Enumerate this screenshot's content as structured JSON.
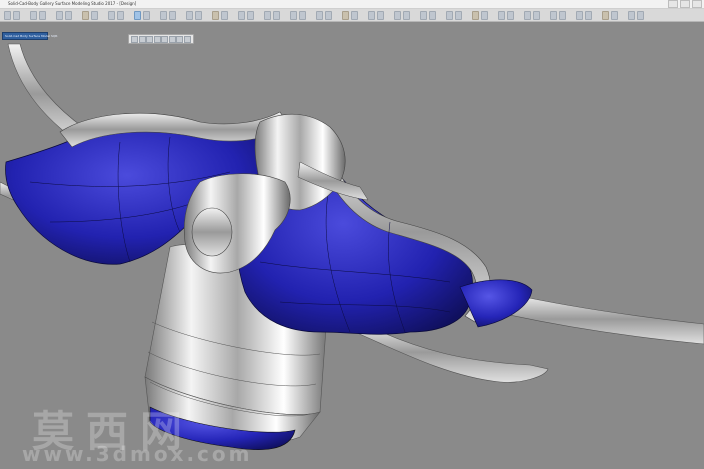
{
  "app": {
    "window_title": "Solid-Cad-Body Gallery Surface Modeling Studio 2017 - [Design]"
  },
  "document": {
    "tab_label": "Solid-Cad Body Surface Model SQR"
  },
  "colors": {
    "viewport_background": "#8a8a8a",
    "body_fill": "#2222b0",
    "body_highlight": "#4b4bdc",
    "chrome_light": "#eaeaea",
    "chrome_dark": "#7a7a7a",
    "titlebar": "#f2f2f2",
    "toolbar": "#d9d9d9",
    "doc_tab": "#2f5f9e"
  },
  "icons": {
    "toolbar": [
      "file-icon",
      "open-icon",
      "save-icon",
      "undo-icon",
      "redo-icon",
      "select-icon",
      "move-icon",
      "rotate-icon",
      "scale-icon",
      "curve-icon",
      "surface-icon",
      "trim-icon",
      "fillet-icon",
      "blend-icon",
      "mirror-icon",
      "array-icon",
      "measure-icon",
      "grid-icon",
      "snap-icon",
      "layer-icon",
      "material-icon",
      "render-icon",
      "camera-icon",
      "light-icon",
      "settings-icon"
    ],
    "view_toolbar": [
      "zoom-icon",
      "pan-icon",
      "orbit-icon",
      "fit-icon",
      "wireframe-icon",
      "shaded-icon",
      "section-icon",
      "camera-icon"
    ]
  },
  "watermark": {
    "text": "莫西网",
    "url": "www.3dmox.com"
  }
}
